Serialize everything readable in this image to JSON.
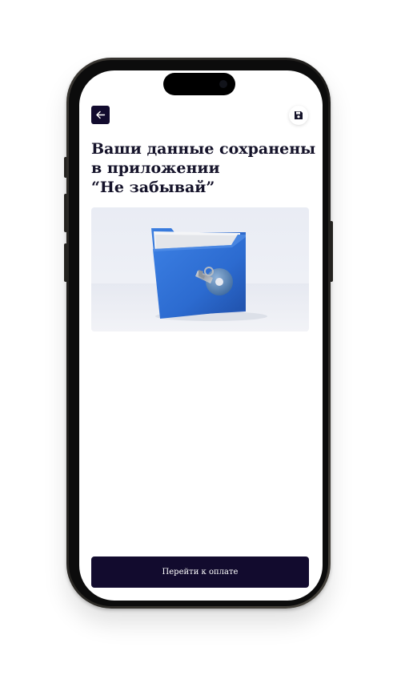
{
  "header": {
    "back_icon": "arrow-left-icon",
    "save_icon": "floppy-disk-icon"
  },
  "content": {
    "title_lines": [
      "Ваши данные сохранены",
      "в приложении",
      "“Не забывай”"
    ],
    "image_subject": "folder-with-key-icon"
  },
  "footer": {
    "pay_button_label": "Перейти к оплате"
  },
  "colors": {
    "primary": "#120b2e",
    "title_text": "#15132a",
    "folder_blue": "#2f6fd1",
    "background": "#ffffff"
  }
}
